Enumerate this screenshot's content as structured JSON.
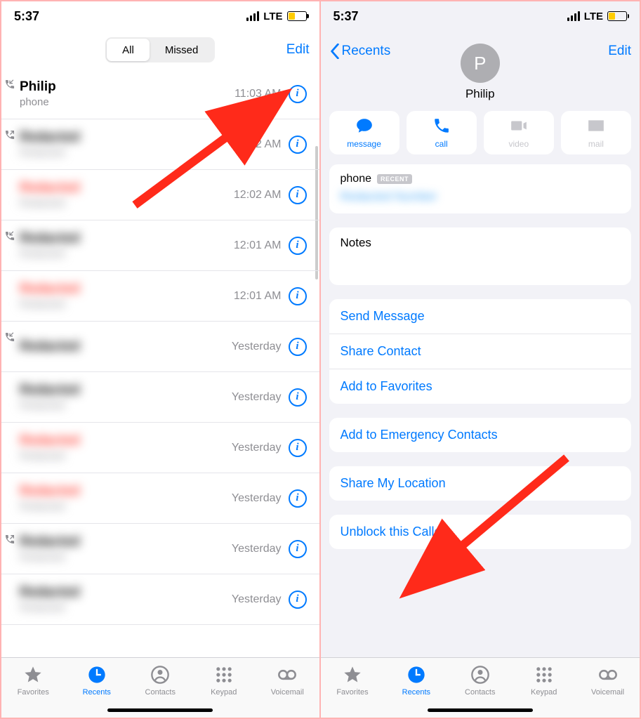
{
  "status": {
    "time": "5:37",
    "net": "LTE"
  },
  "left": {
    "seg": {
      "all": "All",
      "missed": "Missed"
    },
    "edit": "Edit",
    "calls": [
      {
        "name": "Philip",
        "sub": "phone",
        "time": "11:03 AM",
        "missed": false,
        "icon": "incoming"
      },
      {
        "name": "Redacted",
        "sub": "Redacted",
        "time": "12:02 AM",
        "missed": false,
        "icon": "outgoing",
        "blur": true
      },
      {
        "name": "Redacted",
        "sub": "Redacted",
        "time": "12:02 AM",
        "missed": true,
        "blur": true
      },
      {
        "name": "Redacted",
        "sub": "Redacted",
        "time": "12:01 AM",
        "missed": false,
        "icon": "incoming",
        "blur": true
      },
      {
        "name": "Redacted",
        "sub": "Redacted",
        "time": "12:01 AM",
        "missed": true,
        "blur": true
      },
      {
        "name": "Redacted",
        "sub": "",
        "time": "Yesterday",
        "missed": false,
        "icon": "incoming",
        "blur": true
      },
      {
        "name": "Redacted",
        "sub": "Redacted",
        "time": "Yesterday",
        "missed": false,
        "blur": true
      },
      {
        "name": "Redacted",
        "sub": "Redacted",
        "time": "Yesterday",
        "missed": true,
        "blur": true
      },
      {
        "name": "Redacted",
        "sub": "Redacted",
        "time": "Yesterday",
        "missed": true,
        "blur": true
      },
      {
        "name": "Redacted",
        "sub": "Redacted",
        "time": "Yesterday",
        "missed": false,
        "icon": "outgoing",
        "blur": true
      },
      {
        "name": "Redacted",
        "sub": "Redacted",
        "time": "Yesterday",
        "missed": false,
        "blur": true
      }
    ],
    "tabs": {
      "favorites": "Favorites",
      "recents": "Recents",
      "contacts": "Contacts",
      "keypad": "Keypad",
      "voicemail": "Voicemail"
    }
  },
  "right": {
    "back": "Recents",
    "edit": "Edit",
    "avatar": "P",
    "name": "Philip",
    "actions": {
      "message": "message",
      "call": "call",
      "video": "video",
      "mail": "mail"
    },
    "phone": {
      "label": "phone",
      "badge": "RECENT",
      "number": "Redacted Number"
    },
    "notes": "Notes",
    "links1": [
      "Send Message",
      "Share Contact",
      "Add to Favorites"
    ],
    "links2": [
      "Add to Emergency Contacts"
    ],
    "links3": [
      "Share My Location"
    ],
    "links4": [
      "Unblock this Caller"
    ]
  }
}
